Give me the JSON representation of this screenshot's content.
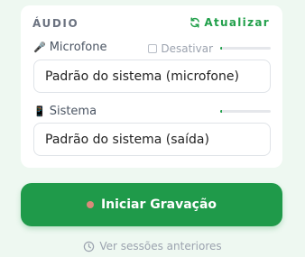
{
  "audio": {
    "section_title": "ÁUDIO",
    "refresh_label": "Atualizar",
    "refresh_icon": "refresh-icon",
    "microphone": {
      "label": "Microfone",
      "icon": "microphone-icon",
      "disable_label": "Desativar",
      "disable_checked": false,
      "level": 0.04,
      "selected": "Padrão do sistema (microfone)"
    },
    "system": {
      "label": "Sistema",
      "icon": "phone-icon",
      "level": 0.04,
      "selected": "Padrão do sistema (saída)"
    }
  },
  "record_button": {
    "label": "Iniciar Gravação",
    "color": "#1f9a4a",
    "dot_color": "#d98a7a"
  },
  "history_link": {
    "label": "Ver sessões anteriores",
    "icon": "clock-icon"
  },
  "colors": {
    "accent": "#22a04b",
    "background": "#eef8f1"
  }
}
